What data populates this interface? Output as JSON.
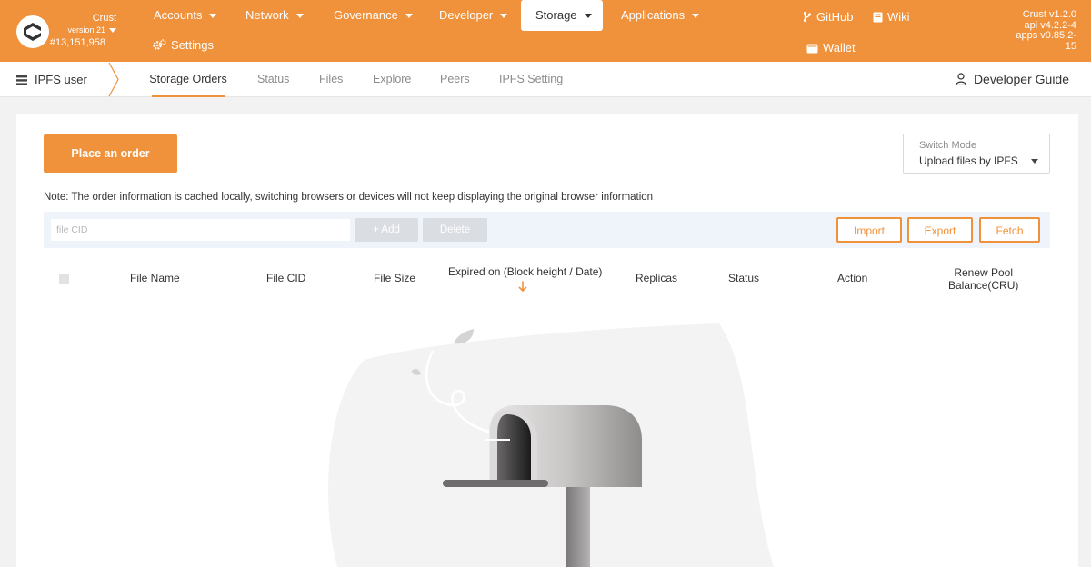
{
  "topbar": {
    "chain": {
      "name": "Crust",
      "version": "version 21",
      "block": "#13,151,958"
    },
    "nav": [
      {
        "label": "Accounts"
      },
      {
        "label": "Network"
      },
      {
        "label": "Governance"
      },
      {
        "label": "Developer"
      },
      {
        "label": "Storage",
        "active": true
      },
      {
        "label": "Applications"
      }
    ],
    "settings_label": "Settings",
    "github_label": "GitHub",
    "wiki_label": "Wiki",
    "wallet_label": "Wallet",
    "versions": {
      "crust": "Crust v1.2.0",
      "api": "api v4.2.2-4",
      "apps": "apps v0.85.2-",
      "apps_suffix": "15"
    }
  },
  "subbar": {
    "section": "IPFS user",
    "tabs": [
      {
        "label": "Storage Orders",
        "active": true
      },
      {
        "label": "Status"
      },
      {
        "label": "Files"
      },
      {
        "label": "Explore"
      },
      {
        "label": "Peers"
      },
      {
        "label": "IPFS Setting"
      }
    ],
    "developer_guide": "Developer Guide"
  },
  "main": {
    "place_order": "Place an order",
    "switch_mode": {
      "label": "Switch Mode",
      "value": "Upload files by IPFS"
    },
    "note": "Note: The order information is cached locally, switching browsers or devices will not keep displaying the original browser information",
    "cid_placeholder": "file CID",
    "add_label": "+ Add",
    "delete_label": "Delete",
    "import_label": "Import",
    "export_label": "Export",
    "fetch_label": "Fetch",
    "columns": {
      "file_name": "File Name",
      "file_cid": "File CID",
      "file_size": "File Size",
      "expired": "Expired on (Block height / Date)",
      "replicas": "Replicas",
      "status": "Status",
      "action": "Action",
      "renew_line1": "Renew Pool",
      "renew_line2": "Balance(CRU)"
    }
  },
  "colors": {
    "brand": "#f0913b",
    "toolbar_bg": "#eef4f9"
  },
  "icons": [
    "crust-logo-icon",
    "gear-icon",
    "github-icon",
    "book-icon",
    "wallet-icon",
    "list-icon",
    "chevron-right-icon",
    "user-icon",
    "chevron-down-icon",
    "sort-down-icon"
  ]
}
